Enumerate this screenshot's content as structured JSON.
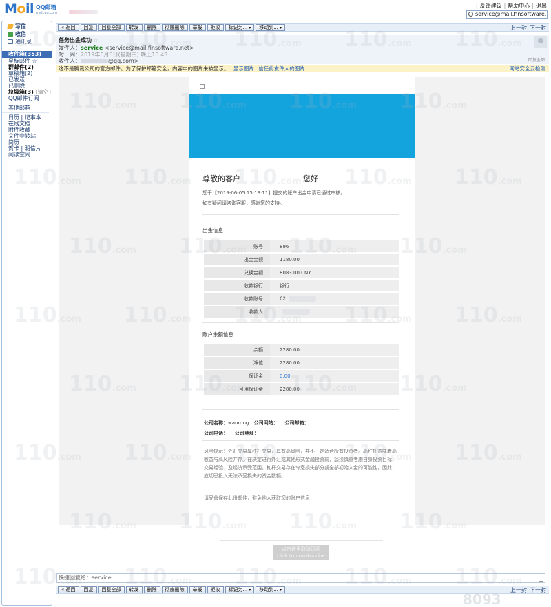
{
  "brand": {
    "logo_main": "Mail",
    "logo_cn": "QQ邮箱",
    "logo_url": "mail.qq.com"
  },
  "topbar": {
    "links": [
      "反馈建议",
      "帮助中心",
      "退出"
    ],
    "search_value": "service@mail.finsoftware.n"
  },
  "sidebar": {
    "write": "写信",
    "inbox": "收信",
    "contacts": "通讯录",
    "inbox_folder": "收件箱(353)",
    "folders": [
      {
        "label": "星标邮件 ☆",
        "bold": false
      },
      {
        "label": "群邮件(2)",
        "bold": true
      },
      {
        "label": "草稿箱(2)",
        "bold": false
      },
      {
        "label": "已发送",
        "bold": false
      },
      {
        "label": "已删除",
        "bold": false
      }
    ],
    "trash": "垃圾箱(3)",
    "trash_clear": "[清空]",
    "subscriptions": "QQ邮件订阅",
    "other_mail": "其他邮箱",
    "tools": [
      "日历 | 记事本",
      "在线文档",
      "附件收藏",
      "文件中转站",
      "简历",
      "贺卡 | 明信片",
      "阅读空间"
    ]
  },
  "toolbar": {
    "buttons": [
      {
        "label": "« 返回",
        "dropdown": false
      },
      {
        "label": "回复",
        "dropdown": false
      },
      {
        "label": "回复全部",
        "dropdown": false
      },
      {
        "label": "转发",
        "dropdown": false
      },
      {
        "label": "删除",
        "dropdown": false
      },
      {
        "label": "彻底删除",
        "dropdown": false
      },
      {
        "label": "举报",
        "dropdown": false
      },
      {
        "label": "拒收",
        "dropdown": false
      },
      {
        "label": "标记为...",
        "dropdown": true
      },
      {
        "label": "移动到...",
        "dropdown": true
      }
    ],
    "prev": "上一封",
    "next": "下一封"
  },
  "email": {
    "subject": "任务出金成功",
    "star": "☆",
    "from_label": "发件人：",
    "from_name": "service",
    "from_addr": "<service@mail.finsoftware.net>",
    "time_label": "时　间：",
    "time_value": "2019年6月5日(星期三) 晚上10:43",
    "to_label": "收件人：",
    "to_value": "@qq.com>",
    "reply_all": "回复全部",
    "warning": "这不是腾讯公司的官方邮件。为了保护邮箱安全，内容中的图片未被显示。",
    "show_images": "显示图片",
    "trust_sender": "信任此发件人的图片",
    "scan_status": "网站安全云检测"
  },
  "content": {
    "greet": "尊敬的客户",
    "greet2": "您好",
    "p1": "您于【2019-06-05 15:13:11】提交的账户出金申请已通过审核。",
    "p2": "如有疑问请咨询客服，感谢您的支持。",
    "section1": "出金信息",
    "withdraw_rows": [
      {
        "k": "账号",
        "v": "896",
        "blur": false,
        "blue": false
      },
      {
        "k": "出金金额",
        "v": "1180.00",
        "blur": false,
        "blue": false
      },
      {
        "k": "兑换金额",
        "v": "8083.00 CNY",
        "blur": false,
        "blue": false
      },
      {
        "k": "收款银行",
        "v": "银行",
        "blur": false,
        "blue": false
      },
      {
        "k": "收款账号",
        "v": "62",
        "blur": true,
        "blue": false
      },
      {
        "k": "收款人",
        "v": "",
        "blur": true,
        "blue": false
      }
    ],
    "section2": "账户余额信息",
    "balance_rows": [
      {
        "k": "余额",
        "v": "2280.00",
        "blur": false,
        "blue": false
      },
      {
        "k": "净值",
        "v": "2280.00",
        "blur": false,
        "blue": false
      },
      {
        "k": "保证金",
        "v": "0.00",
        "blur": false,
        "blue": true
      },
      {
        "k": "可用保证金",
        "v": "2280.00",
        "blur": false,
        "blue": false
      }
    ],
    "company_name_label": "公司名称：",
    "company_name": "wanrong",
    "company_site_label": "公司网站：",
    "company_mail_label": "公司邮箱：",
    "company_phone_label": "公司电话：",
    "company_addr_label": "公司地址：",
    "risk": "风险提示：外汇交易属杠杆交易，具有高风险，并不一定适合所有投资者。高杠杆意味着高收益与高风险并存。在决定进行外汇或其他形式金融投资前，您须慎重考虑自身投资目标、交易经验、及经济承受范围。杠杆交易存在令您损失部分或全部初始入金的可能性，因此，应切忌投入无法承受损失的资金数额。",
    "tip": "请妥善保存此份邮件，避免他人获取您的账户信息",
    "unsub_cn": "点击这里取消订阅",
    "unsub_en": "click to unsubscribe"
  },
  "quickreply_placeholder": "快捷回复给：service",
  "watermark": {
    "big": "110",
    "small": ".com",
    "corner": "8093"
  }
}
